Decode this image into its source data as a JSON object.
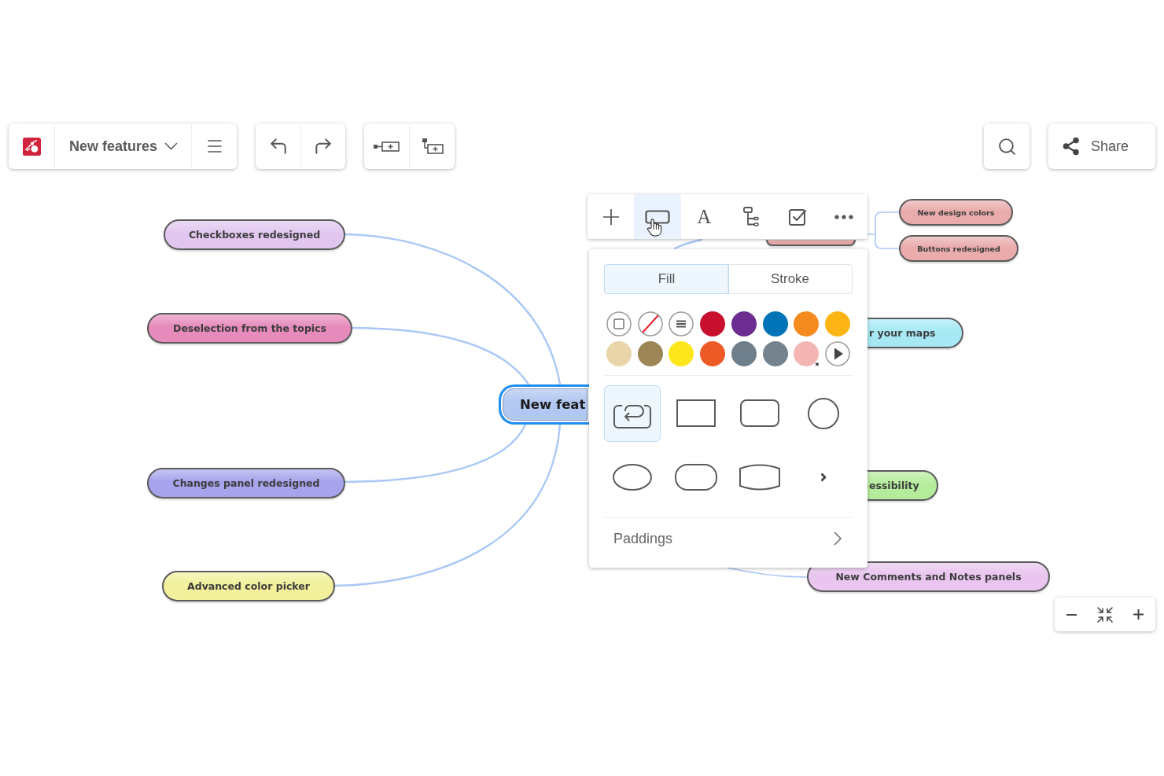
{
  "header": {
    "title": "New features",
    "share_label": "Share"
  },
  "mind_map": {
    "root": {
      "label": "New feat",
      "color": "#b2c7f1",
      "selected": true,
      "children": [
        {
          "label": "Checkboxes redesigned",
          "color": "#e2c6ef",
          "selected": false
        },
        {
          "label": "Deselection from the topics",
          "color": "#e68bbc",
          "selected": false
        },
        {
          "label": "Changes panel redesigned",
          "color": "#a7a3ec",
          "selected": false
        },
        {
          "label": "Advanced color picker",
          "color": "#f2f09b",
          "selected": false
        },
        {
          "color": "#e6a7a7",
          "selected": false,
          "children": [
            {
              "label": "New design colors",
              "color": "#e9abab",
              "selected": false
            },
            {
              "label": "Buttons redesigned",
              "color": "#e9abab",
              "selected": false
            }
          ]
        },
        {
          "label": "r your maps",
          "color": "#a6e9f5",
          "selected": false
        },
        {
          "label": "essibility",
          "color": "#b5ec9b",
          "selected": false
        },
        {
          "label": "New Comments and Notes panels",
          "color": "#e9c5ef",
          "selected": false
        }
      ]
    }
  },
  "node_toolbar": {
    "tools": [
      {
        "kind": "add",
        "selected": false
      },
      {
        "kind": "shape",
        "selected": true
      },
      {
        "kind": "text",
        "glyph": "A",
        "selected": false
      },
      {
        "kind": "structure",
        "selected": false
      },
      {
        "kind": "task",
        "selected": false
      },
      {
        "kind": "more",
        "selected": false
      }
    ]
  },
  "format_panel": {
    "tabs": [
      {
        "label": "Fill",
        "selected": true
      },
      {
        "label": "Stroke",
        "selected": false
      }
    ],
    "swatches": [
      {
        "kind": "no-fill",
        "starred": false
      },
      {
        "kind": "none",
        "starred": false
      },
      {
        "kind": "pattern",
        "starred": false
      },
      {
        "kind": "color",
        "color": "#c8102e",
        "starred": false
      },
      {
        "kind": "color",
        "color": "#6b2d90",
        "starred": false
      },
      {
        "kind": "color",
        "color": "#0074b7",
        "starred": false
      },
      {
        "kind": "color",
        "color": "#f58a1f",
        "starred": false
      },
      {
        "kind": "color",
        "color": "#fdb515",
        "starred": false
      },
      {
        "kind": "color",
        "color": "#e9d5a9",
        "starred": false
      },
      {
        "kind": "color",
        "color": "#9c8655",
        "starred": false
      },
      {
        "kind": "color",
        "color": "#fde619",
        "starred": false
      },
      {
        "kind": "color",
        "color": "#ee5a25",
        "starred": false
      },
      {
        "kind": "color",
        "color": "#6f7f8c",
        "starred": false
      },
      {
        "kind": "color",
        "color": "#75838f",
        "starred": false
      },
      {
        "kind": "color",
        "color": "#f4b5b5",
        "starred": true
      },
      {
        "kind": "more",
        "starred": false
      }
    ],
    "shapes": [
      {
        "kind": "auto",
        "selected": true
      },
      {
        "kind": "rectangle",
        "selected": false
      },
      {
        "kind": "rounded",
        "selected": false
      },
      {
        "kind": "circle",
        "selected": false
      },
      {
        "kind": "ellipse",
        "selected": false
      },
      {
        "kind": "stadium",
        "selected": false
      },
      {
        "kind": "barrel",
        "selected": false
      },
      {
        "kind": "more",
        "selected": false
      }
    ],
    "paddings_label": "Paddings"
  }
}
